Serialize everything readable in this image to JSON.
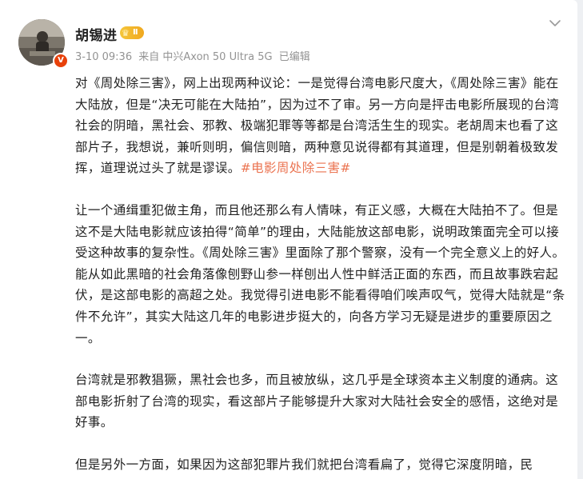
{
  "post": {
    "author": "胡锡进",
    "level_badge": "Ⅱ",
    "time": "3-10 09:36",
    "source": "来自 中兴Axon 50 Ultra 5G",
    "edited": "已编辑",
    "paragraph1": "对《周处除三害》，网上出现两种议论：一是觉得台湾电影尺度大，《周处除三害》能在大陆放，但是“决无可能在大陆拍”，因为过不了审。另一方向是抨击电影所展现的台湾社会的阴暗，黑社会、邪教、极端犯罪等等都是台湾活生生的现实。老胡周末也看了这部片子，我想说，兼听则明，偏信则暗，两种意见说得都有其道理，但是别朝着极致发挥，道理说过头了就是谬误。",
    "hashtag": "#电影周处除三害#",
    "paragraph2": "让一个通缉重犯做主角，而且他还那么有人情味，有正义感，大概在大陆拍不了。但是这不是大陆电影就应该拍得“简单”的理由，大陆能放这部电影，说明政策面完全可以接受这种故事的复杂性。《周处除三害》里面除了那个警察，没有一个完全意义上的好人。能从如此黑暗的社会角落像刨野山参一样刨出人性中鲜活正面的东西，而且故事跌宕起伏，是这部电影的高超之处。我觉得引进电影不能看得咱们唉声叹气，觉得大陆就是“条件不允许”，其实大陆这几年的电影进步挺大的，向各方学习无疑是进步的重要原因之一。",
    "paragraph3": "台湾就是邪教猖獗，黑社会也多，而且被放纵，这几乎是全球资本主义制度的通病。这部电影折射了台湾的现实，看这部片子能够提升大家对大陆社会安全的感悟，这绝对是好事。",
    "paragraph4": "但是另外一方面，如果因为这部犯罪片我们就把台湾看扁了，觉得它深度阴暗，民"
  },
  "icons": {
    "menu": "chevron-down-icon",
    "avatar_badge": "verified-v-icon",
    "level": "crown-icon"
  },
  "colors": {
    "hashtag": "#eb7350",
    "meta": "#939393",
    "badge_gold": "#f0a81f",
    "verified_orange": "#e8410a"
  }
}
